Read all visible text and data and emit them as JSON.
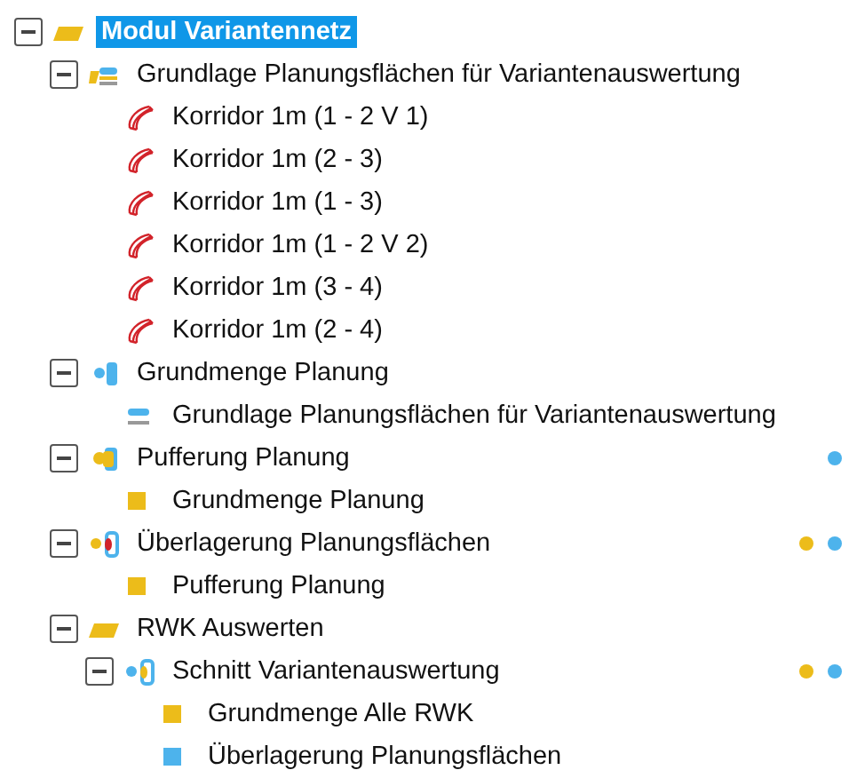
{
  "tree": [
    {
      "label": "Modul Variantennetz",
      "kind": "folder",
      "expanded": true,
      "selected": true,
      "children": [
        {
          "label": "Grundlage Planungsflächen für Variantenauswertung",
          "kind": "group",
          "expanded": true,
          "selected": false,
          "children": [
            {
              "label": "Korridor 1m (1 - 2 V 1)",
              "kind": "corridor",
              "selected": false
            },
            {
              "label": "Korridor 1m (2 - 3)",
              "kind": "corridor",
              "selected": false
            },
            {
              "label": "Korridor 1m (1 - 3)",
              "kind": "corridor",
              "selected": false
            },
            {
              "label": "Korridor 1m (1 - 2 V 2)",
              "kind": "corridor",
              "selected": false
            },
            {
              "label": "Korridor 1m (3 - 4)",
              "kind": "corridor",
              "selected": false
            },
            {
              "label": "Korridor 1m (2 - 4)",
              "kind": "corridor",
              "selected": false
            }
          ]
        },
        {
          "label": "Grundmenge Planung",
          "kind": "process-blue",
          "expanded": true,
          "selected": false,
          "children": [
            {
              "label": "Grundlage Planungsflächen für Variantenauswertung",
              "kind": "layer",
              "selected": false
            }
          ]
        },
        {
          "label": "Pufferung Planung",
          "kind": "process-yellow",
          "expanded": true,
          "selected": false,
          "markers": [
            {
              "color": "#4db3ec"
            }
          ],
          "children": [
            {
              "label": "Grundmenge Planung",
              "kind": "square",
              "color": "#ecbc1a",
              "selected": false
            }
          ]
        },
        {
          "label": "Überlagerung Planungsflächen",
          "kind": "process-mixed",
          "expanded": true,
          "selected": false,
          "markers": [
            {
              "color": "#ecbc1a"
            },
            {
              "color": "#4db3ec"
            }
          ],
          "children": [
            {
              "label": "Pufferung Planung",
              "kind": "square",
              "color": "#ecbc1a",
              "selected": false
            }
          ]
        },
        {
          "label": "RWK Auswerten",
          "kind": "folder",
          "expanded": true,
          "selected": false,
          "children": [
            {
              "label": "Schnitt Variantenauswertung",
              "kind": "process-cut",
              "expanded": true,
              "selected": false,
              "markers": [
                {
                  "color": "#ecbc1a"
                },
                {
                  "color": "#4db3ec"
                }
              ],
              "children": [
                {
                  "label": "Grundmenge Alle RWK",
                  "kind": "square",
                  "color": "#ecbc1a",
                  "selected": false
                },
                {
                  "label": "Überlagerung Planungsflächen",
                  "kind": "square",
                  "color": "#4db3ec",
                  "selected": false
                }
              ]
            }
          ]
        }
      ]
    }
  ]
}
